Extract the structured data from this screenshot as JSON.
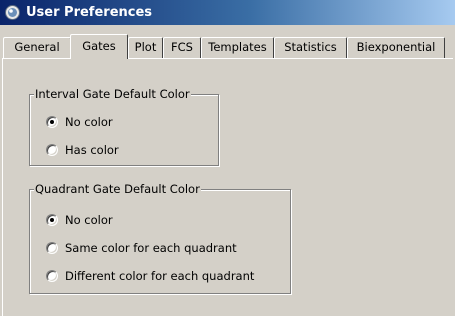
{
  "window": {
    "title": "User Preferences",
    "icon": "app-icon"
  },
  "tabs": [
    {
      "label": "General",
      "active": false
    },
    {
      "label": "Gates",
      "active": true
    },
    {
      "label": "Plot",
      "active": false
    },
    {
      "label": "FCS",
      "active": false
    },
    {
      "label": "Templates",
      "active": false
    },
    {
      "label": "Statistics",
      "active": false
    },
    {
      "label": "Biexponential",
      "active": false
    }
  ],
  "interval_gate": {
    "title": "Interval Gate Default Color",
    "options": [
      {
        "label": "No color",
        "selected": true
      },
      {
        "label": "Has color",
        "selected": false
      }
    ]
  },
  "quadrant_gate": {
    "title": "Quadrant Gate Default Color",
    "options": [
      {
        "label": "No color",
        "selected": true
      },
      {
        "label": "Same color for each quadrant",
        "selected": false
      },
      {
        "label": "Different color for each quadrant",
        "selected": false
      }
    ]
  },
  "colors": {
    "titlebar_start": "#0a246a",
    "titlebar_end": "#a6caf0",
    "face": "#d4d0c8"
  }
}
